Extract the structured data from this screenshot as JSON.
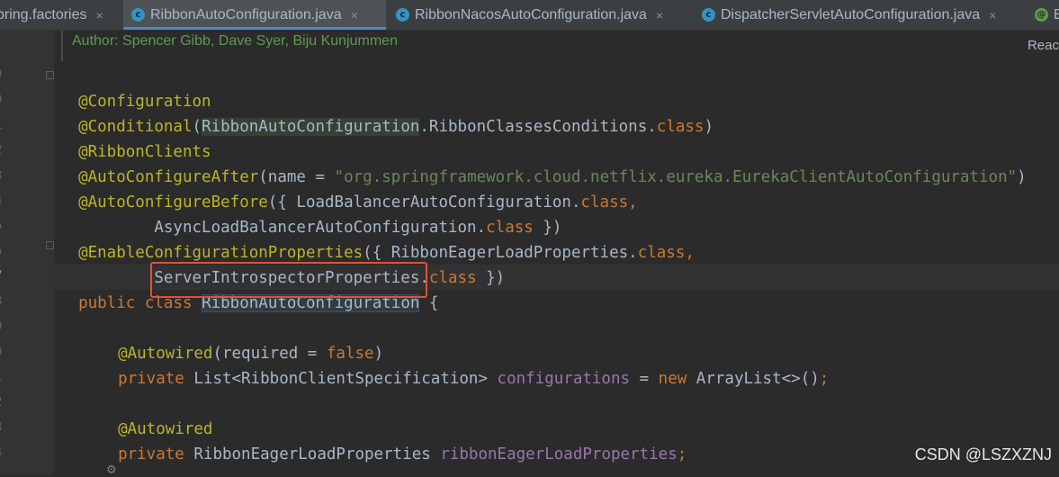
{
  "tabs": [
    {
      "label": "pring.factories",
      "icon": "none",
      "active": false
    },
    {
      "label": "RibbonAutoConfiguration.java",
      "icon": "class-icon",
      "active": true
    },
    {
      "label": "RibbonNacosAutoConfiguration.java",
      "icon": "class-icon",
      "active": false
    },
    {
      "label": "DispatcherServletAutoConfiguration.java",
      "icon": "class-icon",
      "active": false
    },
    {
      "label": "E",
      "icon": "annot-icon",
      "active": false
    }
  ],
  "tab_close_glyph": "×",
  "doc_comment": "Author: Spencer Gibb, Dave Syer, Biju Kunjummen",
  "reader_mode": "Reac",
  "line_numbers": [
    "9",
    "0",
    "1",
    "2",
    "3",
    "4",
    "5",
    "6",
    "7",
    "8",
    "9",
    "0",
    "1",
    "2",
    "3",
    "4",
    ""
  ],
  "code": {
    "l1": {
      "anno": "@Configuration"
    },
    "l2": {
      "anno": "@Conditional",
      "p1": "(",
      "cls": "RibbonAutoConfiguration",
      "p2": ".RibbonClassesConditions.",
      "kw": "class",
      "p3": ")"
    },
    "l3": {
      "anno": "@RibbonClients"
    },
    "l4": {
      "anno": "@AutoConfigureAfter",
      "p1": "(name = ",
      "str": "\"org.springframework.cloud.netflix.eureka.EurekaClientAutoConfiguration\"",
      "p2": ")"
    },
    "l5": {
      "anno": "@AutoConfigureBefore",
      "p1": "({ LoadBalancerAutoConfiguration.",
      "kw": "class",
      "p2": ","
    },
    "l6": {
      "p1": "        AsyncLoadBalancerAutoConfiguration.",
      "kw": "class",
      "p2": " })"
    },
    "l7": {
      "anno": "@EnableConfigurationProperties",
      "p1": "({ RibbonEagerLoadProperties.",
      "kw": "class",
      "p2": ","
    },
    "l8": {
      "p1": "        ServerIntrospectorProperties.",
      "kw": "class",
      "p2": " })"
    },
    "l9": {
      "kw1": "public",
      "sp": " ",
      "kw2": "class",
      "sp2": " ",
      "cls": "RibbonAutoConfiguration",
      "p1": " {"
    },
    "l11": {
      "anno": "@Autowired",
      "p1": "(required = ",
      "kw": "false",
      "p2": ")"
    },
    "l12": {
      "kw": "private",
      "p1": " List<RibbonClientSpecification> ",
      "field": "configurations",
      "p2": " = ",
      "kw2": "new",
      "p3": " ArrayList<>()",
      "semi": ";"
    },
    "l14": {
      "anno": "@Autowired"
    },
    "l15": {
      "kw": "private",
      "p1": " RibbonEagerLoadProperties ",
      "field": "ribbonEagerLoadProperties",
      "semi": ";"
    }
  },
  "watermark": "CSDN @LSZXZNJ"
}
